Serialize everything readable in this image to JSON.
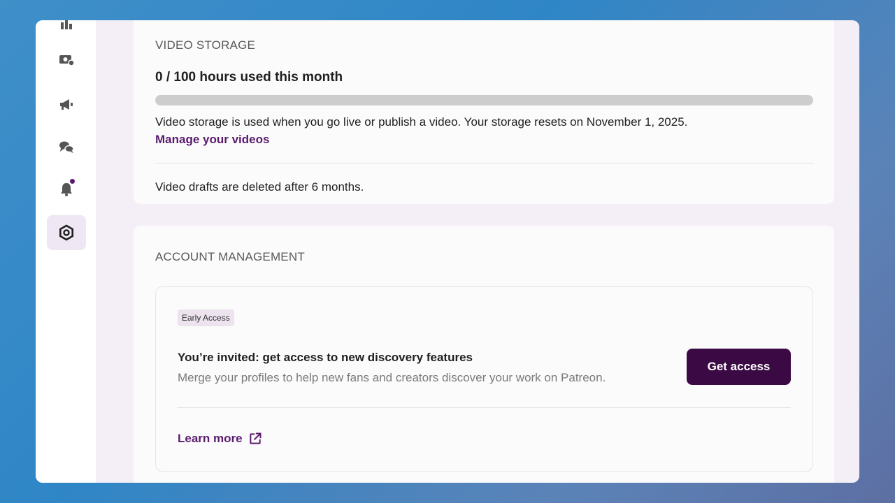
{
  "sidebar": {
    "items": [
      {
        "icon": "dashboard-icon"
      },
      {
        "icon": "payouts-icon"
      },
      {
        "icon": "promotions-megaphone-icon"
      },
      {
        "icon": "chat-icon",
        "has_dot": false
      },
      {
        "icon": "notifications-bell-icon",
        "has_dot": true
      },
      {
        "icon": "settings-gear-icon",
        "active": true
      }
    ]
  },
  "video_storage": {
    "title": "VIDEO STORAGE",
    "usage": "0 / 100 hours used this month",
    "progress": 0,
    "description": "Video storage is used when you go live or publish a video. Your storage resets on November 1, 2025.",
    "manage_link": "Manage your videos",
    "drafts_note": "Video drafts are deleted after 6 months."
  },
  "account_management": {
    "title": "ACCOUNT MANAGEMENT",
    "badge": "Early Access",
    "invite_title": "You’re invited: get access to new discovery features",
    "invite_subtitle": "Merge your profiles to help new fans and creators discover your work on Patreon.",
    "cta_label": "Get access",
    "learn_more": "Learn more"
  },
  "colors": {
    "accent": "#5a1a6e",
    "cta_bg": "#3b0a45",
    "track": "#cdcdcd"
  }
}
